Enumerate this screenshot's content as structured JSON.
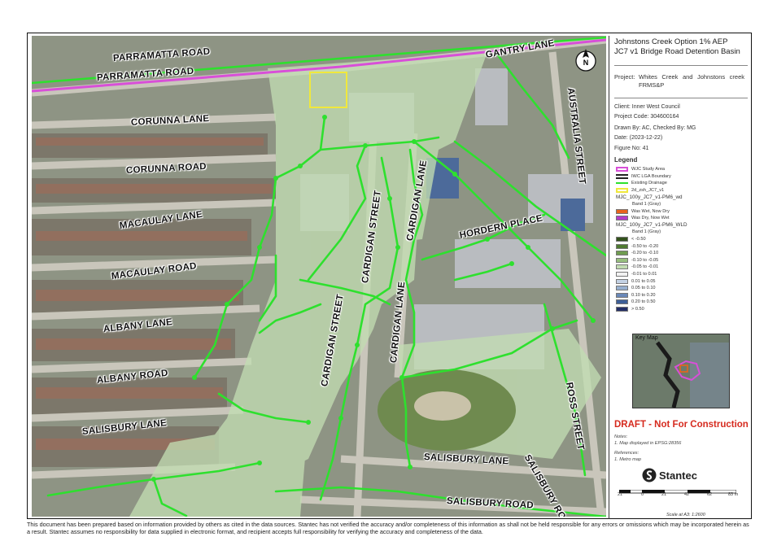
{
  "map": {
    "streets": [
      {
        "id": "parramatta-road-1",
        "text": "PARRAMATTA ROAD"
      },
      {
        "id": "parramatta-road-2",
        "text": "PARRAMATTA ROAD"
      },
      {
        "id": "corunna-lane",
        "text": "CORUNNA LANE"
      },
      {
        "id": "corunna-road",
        "text": "CORUNNA ROAD"
      },
      {
        "id": "macaulay-lane",
        "text": "MACAULAY LANE"
      },
      {
        "id": "macaulay-road",
        "text": "MACAULAY ROAD"
      },
      {
        "id": "albany-lane",
        "text": "ALBANY LANE"
      },
      {
        "id": "albany-road",
        "text": "ALBANY ROAD"
      },
      {
        "id": "salisbury-lane-w",
        "text": "SALISBURY LANE"
      },
      {
        "id": "cardigan-street-n",
        "text": "CARDIGAN STREET"
      },
      {
        "id": "cardigan-lane-n",
        "text": "CARDIGAN LANE"
      },
      {
        "id": "cardigan-lane-s",
        "text": "CARDIGAN LANE"
      },
      {
        "id": "cardigan-street-s",
        "text": "CARDIGAN STREET"
      },
      {
        "id": "hordern-place",
        "text": "HORDERN PLACE"
      },
      {
        "id": "gantry-lane",
        "text": "GANTRY LANE"
      },
      {
        "id": "australia-street",
        "text": "AUSTRALIA STREET"
      },
      {
        "id": "ross-street",
        "text": "ROSS STREET"
      },
      {
        "id": "salisbury-lane-s",
        "text": "SALISBURY LANE"
      },
      {
        "id": "salisbury-road",
        "text": "SALISBURY ROAD"
      },
      {
        "id": "salisbury-road-2",
        "text": "SALISBURY ROAD"
      }
    ],
    "north_label": "N"
  },
  "panel": {
    "title_line1": "Johnstons Creek Option 1% AEP",
    "title_line2": "JC7 v1 Bridge Road Detention Basin",
    "project_label": "Project:",
    "project_value": "Whites Creek and Johnstons creek FRMS&P",
    "client": "Client:  Inner West Council",
    "project_code": "Project Code:  304600164",
    "drawn_by": "Drawn By:  AC, Checked By: MG",
    "date": "Date:  (2023-12-22)",
    "figure": "Figure No:  41",
    "legend_title": "Legend",
    "legend": [
      {
        "label": "WJC Study Area",
        "color": "#d84fd8",
        "kind": "outline"
      },
      {
        "label": "IWC LGA Boundary",
        "color": "#222222",
        "kind": "double"
      },
      {
        "label": "Existing Drainage",
        "color": "#2ee02e",
        "kind": "line"
      },
      {
        "label": "2d_zsh_JC7_v1",
        "color": "#f0e83c",
        "kind": "outline"
      },
      {
        "label": "MJC_100y_JC7_v1-PM6_wd",
        "color": "",
        "kind": "header"
      },
      {
        "label": "Band 1 (Gray)",
        "color": "",
        "kind": "sub"
      },
      {
        "label": "Was Wet, Now Dry",
        "color": "#e8641c",
        "kind": "fill"
      },
      {
        "label": "Was Dry, Now Wet",
        "color": "#b43cc8",
        "kind": "fill"
      },
      {
        "label": "MJC_100y_JC7_v1-PM6_WLD",
        "color": "",
        "kind": "header"
      },
      {
        "label": "Band 1 (Gray)",
        "color": "",
        "kind": "sub"
      },
      {
        "label": "< -0.50",
        "color": "#33521c",
        "kind": "fill"
      },
      {
        "label": "-0.50 to -0.20",
        "color": "#4f7a31",
        "kind": "fill"
      },
      {
        "label": "-0.20 to -0.10",
        "color": "#6f9c50",
        "kind": "fill"
      },
      {
        "label": "-0.10 to -0.05",
        "color": "#97bf7e",
        "kind": "fill"
      },
      {
        "label": "-0.05 to -0.01",
        "color": "#c2dcb2",
        "kind": "fill"
      },
      {
        "label": "-0.01 to 0.01",
        "color": "#f2f2f2",
        "kind": "fill"
      },
      {
        "label": "0.01 to 0.05",
        "color": "#c4d2e4",
        "kind": "fill"
      },
      {
        "label": "0.05 to 0.10",
        "color": "#97afcf",
        "kind": "fill"
      },
      {
        "label": "0.10 to 0.20",
        "color": "#6a88b8",
        "kind": "fill"
      },
      {
        "label": "0.20 to 0.50",
        "color": "#3e5f98",
        "kind": "fill"
      },
      {
        "label": "> 0.50",
        "color": "#232e66",
        "kind": "fill"
      }
    ],
    "keymap_title": "Key Map",
    "draft": "DRAFT - Not For Construction",
    "notes_title": "Notes:",
    "note1": "1. Map displayed in EPSG:28356",
    "references_title": "References:",
    "ref1": "1. Metro map",
    "logo": "Stantec",
    "scale_ticks": [
      "21",
      "0",
      "21",
      "42",
      "62",
      "83 m"
    ],
    "scale": "Scale at A3: 1:2600"
  },
  "disclaimer": "This document has been prepared based on information provided by others as cited in the data sources. Stantec has not verified the accuracy and/or completeness of this information as shall not be held responsible for any errors or omissions which may be incorporated herein as a result. Stantec assumes no responsibility for data supplied in electronic format, and recipient accepts full responsibility for verifying the accuracy and completeness of the data.",
  "colors": {
    "drainage": "#2ee02e",
    "study_area": "#d84fd8",
    "basin": "#f0e83c",
    "flood_change": "#c2dcb2",
    "draft": "#d62a1e"
  }
}
